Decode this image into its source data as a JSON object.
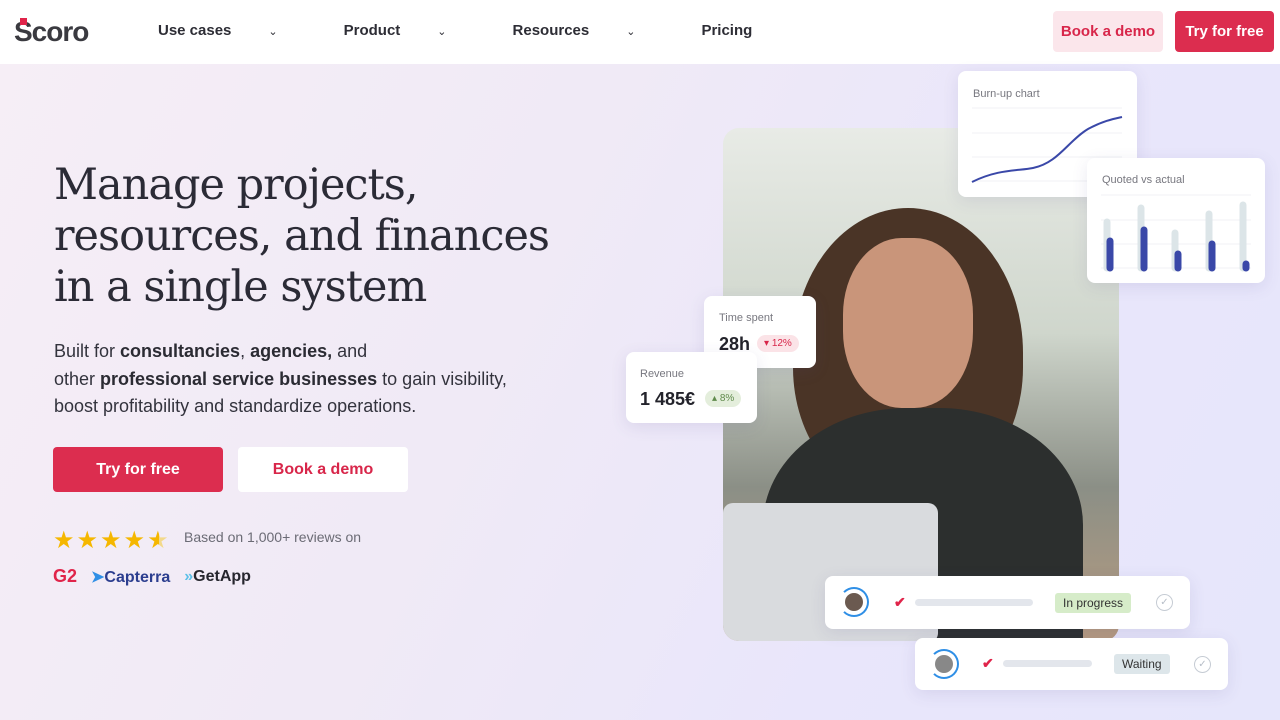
{
  "header": {
    "logo": "Scoro",
    "nav": [
      {
        "label": "Use cases",
        "dropdown": true
      },
      {
        "label": "Product",
        "dropdown": true
      },
      {
        "label": "Resources",
        "dropdown": true
      },
      {
        "label": "Pricing",
        "dropdown": false
      }
    ],
    "book_demo": "Book a demo",
    "try_free": "Try for free"
  },
  "hero": {
    "title_lines": [
      "Manage projects,",
      "resources, and finances",
      "in a single system"
    ],
    "sub": {
      "p1": "Built for ",
      "b1": "consultancies",
      ", ": ", ",
      "b2": "agencies,",
      "p2": " and",
      "p3": "other ",
      "b3": "professional service businesses",
      "p4": " to gain visibility,",
      "p5": "boost profitability and standardize operations."
    },
    "try_free": "Try for free",
    "book_demo": "Book a demo",
    "rating": 4.5,
    "reviews_text": "Based on 1,000+ reviews on",
    "brands": [
      "G2",
      "Capterra",
      "GetApp"
    ]
  },
  "widgets": {
    "burnup": {
      "title": "Burn-up chart"
    },
    "quoted": {
      "title": "Quoted vs actual",
      "quoted": [
        46,
        60,
        35,
        54,
        63
      ],
      "actual": [
        27,
        38,
        14,
        24,
        4
      ]
    },
    "time": {
      "label": "Time spent",
      "value": "28h",
      "delta": "12%",
      "direction": "down"
    },
    "revenue": {
      "label": "Revenue",
      "value": "1 485€",
      "delta": "8%",
      "direction": "up"
    },
    "tasks": [
      {
        "status": "In progress",
        "color": "#d6ecc9"
      },
      {
        "status": "Waiting",
        "color": "#dde6ea"
      }
    ]
  },
  "colors": {
    "accent": "#e0244a",
    "chart": "#3a48a8"
  }
}
